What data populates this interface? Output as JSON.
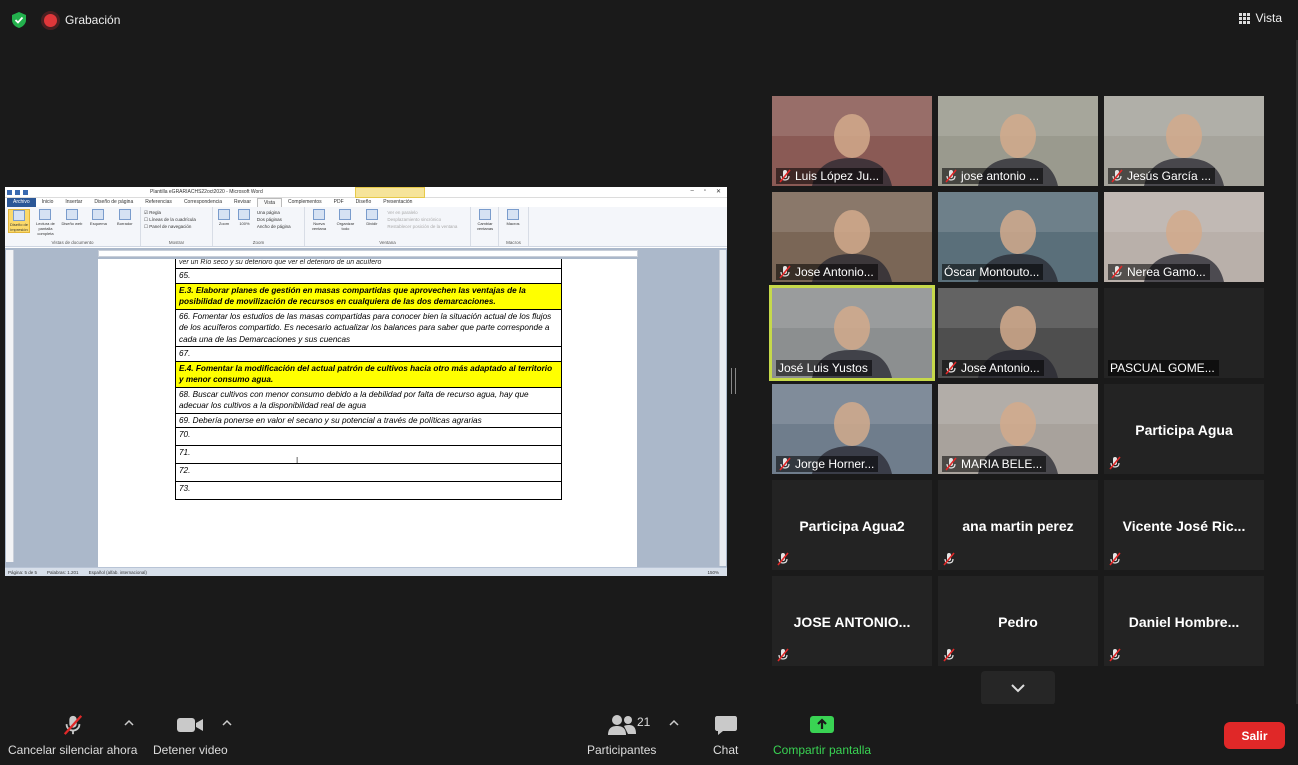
{
  "topbar": {
    "recording_label": "Grabación",
    "view_label": "Vista"
  },
  "word": {
    "title": "Plantilla eGRARIACHS22oct2020 - Microsoft Word",
    "context_tab": "Herramientas de tabla",
    "menu": [
      "Archivo",
      "Inicio",
      "Insertar",
      "Diseño de página",
      "Referencias",
      "Correspondencia",
      "Revisar",
      "Vista",
      "Complementos",
      "PDF",
      "Diseño",
      "Presentación"
    ],
    "ribbon": {
      "doc_views": [
        "Diseño de impresión",
        "Lectura de pantalla completa",
        "Diseño web",
        "Esquema",
        "Borrador"
      ],
      "doc_views_label": "Vistas de documento",
      "show": [
        "Regla",
        "Líneas de la cuadrícula",
        "Panel de navegación"
      ],
      "show_label": "Mostrar",
      "zoom_btns": [
        "Zoom",
        "100%"
      ],
      "zoom_list": [
        "Una página",
        "Dos páginas",
        "Ancho de página"
      ],
      "zoom_label": "Zoom",
      "window_btns": [
        "Nueva ventana",
        "Organizar todo",
        "Dividir"
      ],
      "window_list": [
        "Ver en paralelo",
        "Desplazamiento sincrónico",
        "Restablecer posición de la ventana"
      ],
      "window_label": "Ventana",
      "switch_btn": "Cambiar ventanas",
      "macros_btn": "Macros",
      "macros_label": "Macros"
    },
    "doc_rows": [
      {
        "text": "ver un Río seco y su deterioro que ver el deterioro de un acuífero",
        "type": "cut"
      },
      {
        "text": "65.",
        "type": "plain"
      },
      {
        "text": "E.3. Elaborar planes de gestión en masas compartidas que aprovechen las ventajas de la posibilidad de movilización de recursos en cualquiera de las dos demarcaciones.",
        "type": "hl"
      },
      {
        "text": "66. Fomentar los estudios de las masas compartidas para conocer bien la situación actual de los flujos de los acuíferos compartido. Es necesario actualizar los balances para saber que parte corresponde a cada una de las Demarcaciones y sus cuencas",
        "type": "plain"
      },
      {
        "text": "67.",
        "type": "plain"
      },
      {
        "text": "E.4. Fomentar la modificación del actual patrón de cultivos hacia otro más adaptado al territorio y menor consumo agua.",
        "type": "hl"
      },
      {
        "text": "68. Buscar cultivos con menor consumo debido a la debilidad por falta de recurso agua, hay que adecuar los cultivos a la disponibilidad real de agua",
        "type": "plain"
      },
      {
        "text": "69. Debería ponerse en valor el secano y su potencial a través de políticas agrarias",
        "type": "plain"
      },
      {
        "text": "70.",
        "type": "small"
      },
      {
        "text": "71.",
        "type": "small"
      },
      {
        "text": "72.",
        "type": "small"
      },
      {
        "text": "73.",
        "type": "small"
      }
    ],
    "status": {
      "page": "Página: 5 de 5",
      "words": "Palabras: 1.201",
      "lang": "Español (alfab. internacional)",
      "zoom": "150%"
    }
  },
  "participants": [
    {
      "name": "Luis López Ju...",
      "video": true,
      "muted": true,
      "color": "#8a5a55"
    },
    {
      "name": "jose antonio ...",
      "video": true,
      "muted": true,
      "color": "#9a9a8e"
    },
    {
      "name": "Jesús García ...",
      "video": true,
      "muted": true,
      "color": "#a6a49c"
    },
    {
      "name": "Jose Antonio...",
      "video": true,
      "muted": true,
      "color": "#7a6656"
    },
    {
      "name": "Óscar Montouto...",
      "video": true,
      "muted": false,
      "color": "#5a6f7a"
    },
    {
      "name": "Nerea Gamo...",
      "video": true,
      "muted": true,
      "color": "#b9b0aa"
    },
    {
      "name": "José Luis Yustos",
      "video": true,
      "muted": false,
      "color": "#8c8f90",
      "speaking": true
    },
    {
      "name": "Jose Antonio...",
      "video": true,
      "muted": true,
      "color": "#4e4e4e"
    },
    {
      "name": "PASCUAL GOME...",
      "video": false,
      "muted": false
    },
    {
      "name": "Jorge Horner...",
      "video": true,
      "muted": true,
      "color": "#6f7d8c"
    },
    {
      "name": "MARIA BELE...",
      "video": true,
      "muted": true,
      "color": "#a8a29c"
    },
    {
      "name": "Participa Agua",
      "video": false,
      "muted": true
    },
    {
      "name": "Participa Agua2",
      "video": false,
      "muted": true
    },
    {
      "name": "ana martin perez",
      "video": false,
      "muted": true
    },
    {
      "name": "Vicente José Ric...",
      "video": false,
      "muted": true
    },
    {
      "name": "JOSE ANTONIO...",
      "video": false,
      "muted": true
    },
    {
      "name": "Pedro",
      "video": false,
      "muted": true
    },
    {
      "name": "Daniel Hombre...",
      "video": false,
      "muted": true
    }
  ],
  "toolbar": {
    "unmute_label": "Cancelar silenciar ahora",
    "stop_video_label": "Detener video",
    "participants_label": "Participantes",
    "participants_count": "21",
    "chat_label": "Chat",
    "share_label": "Compartir pantalla",
    "leave_label": "Salir"
  },
  "colors": {
    "accent_green": "#39d353",
    "leave_red": "#e02828",
    "speaking": "#c6d94a"
  }
}
